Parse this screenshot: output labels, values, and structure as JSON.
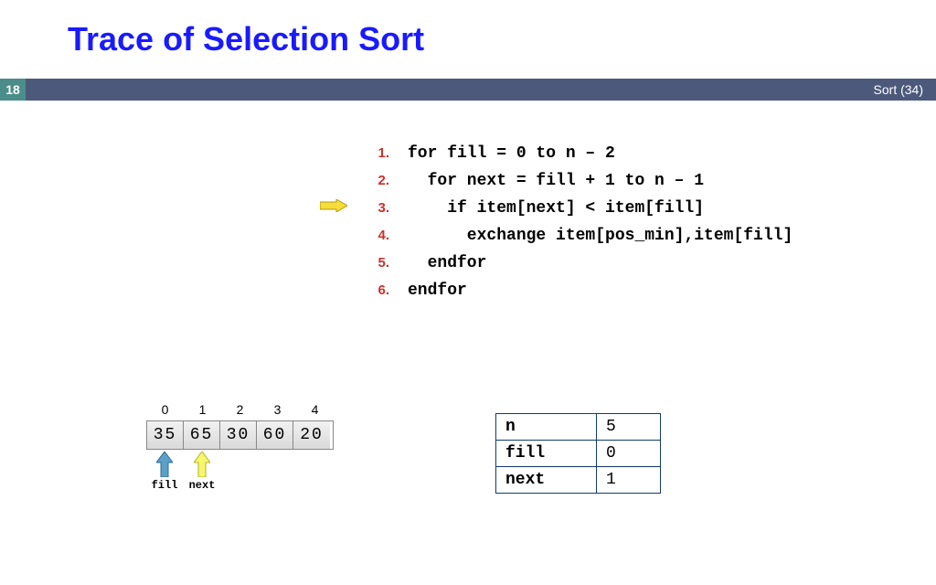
{
  "title": "Trace of Selection Sort",
  "slide_number": "18",
  "chapter_label": "Sort (34)",
  "code": {
    "current_line_index": 2,
    "lines": [
      {
        "num": "1.",
        "indent": 0,
        "text": "for fill = 0 to n – 2"
      },
      {
        "num": "2.",
        "indent": 1,
        "text": "for next = fill + 1 to n – 1"
      },
      {
        "num": "3.",
        "indent": 2,
        "text": "if item[next] < item[fill]"
      },
      {
        "num": "4.",
        "indent": 3,
        "text": "exchange item[pos_min],item[fill]"
      },
      {
        "num": "5.",
        "indent": 1,
        "text": "endfor"
      },
      {
        "num": "6.",
        "indent": 0,
        "text": "endfor"
      }
    ]
  },
  "array": {
    "indices": [
      "0",
      "1",
      "2",
      "3",
      "4"
    ],
    "values": [
      "35",
      "65",
      "30",
      "60",
      "20"
    ],
    "pointers": [
      {
        "label": "fill",
        "pos": 0,
        "fill": "#5aa0c8",
        "stroke": "#2e6e93"
      },
      {
        "label": "next",
        "pos": 1,
        "fill": "#f7f76a",
        "stroke": "#b3b32e"
      }
    ]
  },
  "vars": [
    {
      "name": "n",
      "value": "5"
    },
    {
      "name": "fill",
      "value": "0"
    },
    {
      "name": "next",
      "value": "1"
    }
  ],
  "marker_color": {
    "fill": "#f7dc3a",
    "stroke": "#b39a1a"
  }
}
